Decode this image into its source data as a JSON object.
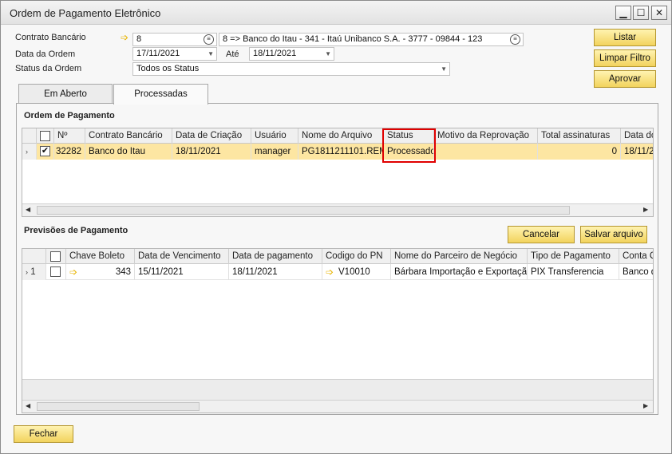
{
  "window": {
    "title": "Ordem de Pagamento Eletrônico",
    "controls": {
      "minimize": "▁",
      "maximize": "☐",
      "close": "✕"
    }
  },
  "filters": {
    "contrato_label": "Contrato Bancário",
    "contrato_value": "8",
    "contrato_desc": "8 => Banco do Itau - 341 - Itaú Unibanco  S.A. - 3777 - 09844 - 123",
    "data_label": "Data da Ordem",
    "data_from": "17/11/2021",
    "ate_label": "Até",
    "data_to": "18/11/2021",
    "status_label": "Status da Ordem",
    "status_value": "Todos os Status"
  },
  "buttons": {
    "listar": "Listar",
    "limpar": "Limpar Filtro",
    "aprovar": "Aprovar",
    "cancelar": "Cancelar",
    "salvar": "Salvar arquivo",
    "fechar": "Fechar"
  },
  "tabs": [
    {
      "label": "Em Aberto"
    },
    {
      "label": "Processadas"
    }
  ],
  "ordem": {
    "title": "Ordem de Pagamento",
    "columns": [
      "",
      "Nº",
      "Contrato Bancário",
      "Data de Criação",
      "Usuário",
      "Nome do Arquivo",
      "Status",
      "Motivo da Reprovação",
      "Total assinaturas",
      "Data do"
    ],
    "rows": [
      {
        "checked": true,
        "num": "32282",
        "contrato": "Banco do Itau",
        "data": "18/11/2021",
        "usuario": "manager",
        "arquivo": "PG1811211101.REM",
        "status": "Processado",
        "motivo": "",
        "total": "0",
        "data_do": "18/11/2"
      }
    ]
  },
  "previsoes": {
    "title": "Previsões de Pagamento",
    "columns": [
      "",
      "Chave Boleto",
      "Data de Vencimento",
      "Data de pagamento",
      "Codigo do PN",
      "Nome do Parceiro de Negócio",
      "Tipo de Pagamento",
      "Conta C"
    ],
    "rows": [
      {
        "index": "1",
        "checked": false,
        "chave": "343",
        "vencimento": "15/11/2021",
        "pagamento": "18/11/2021",
        "codigo": "V10010",
        "parceiro": "Bárbara Importação e Exportação",
        "tipo": "PIX Transferencia",
        "conta": "Banco d"
      }
    ]
  },
  "colors": {
    "accent_yellow": "#f2d35e",
    "selected_row": "#fde6a2",
    "highlight_box": "#e00000"
  }
}
